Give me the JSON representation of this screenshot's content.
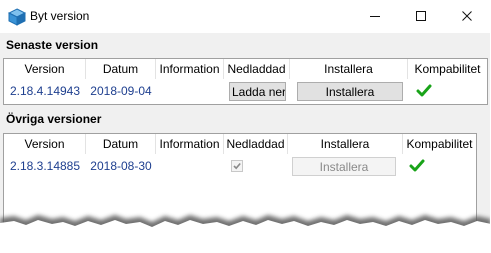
{
  "window": {
    "title": "Byt version",
    "icon": "box-icon",
    "controls": {
      "minimize": "minimize-icon",
      "maximize": "maximize-icon",
      "close": "close-icon"
    }
  },
  "latest": {
    "title": "Senaste version",
    "columns": [
      "Version",
      "Datum",
      "Information",
      "Nedladdad",
      "Installera",
      "Kompabilitet"
    ],
    "row": {
      "version": "2.18.4.14943",
      "date": "2018-09-04",
      "download_label": "Ladda ner",
      "install_label": "Installera",
      "compatible": true
    }
  },
  "others": {
    "title": "Övriga versioner",
    "columns": [
      "Version",
      "Datum",
      "Information",
      "Nedladdad",
      "Installera",
      "Kompabilitet"
    ],
    "rows": [
      {
        "version": "2.18.3.14885",
        "date": "2018-08-30",
        "downloaded": true,
        "install_label": "Installera",
        "install_enabled": false,
        "compatible": true
      }
    ]
  },
  "colors": {
    "value_text": "#1e3f8f",
    "check_green": "#19a319",
    "panel_border": "#a0a0a0"
  }
}
